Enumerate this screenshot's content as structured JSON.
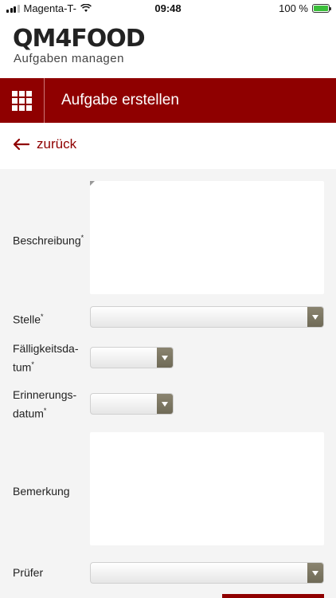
{
  "status_bar": {
    "carrier": "Magenta-T-",
    "time": "09:48",
    "battery": "100 %",
    "signal_icon": "signal-bars-icon",
    "wifi_icon": "wifi-icon",
    "battery_icon": "battery-charging-icon"
  },
  "brand": {
    "logo": "QM4FOOD",
    "tagline": "Aufgaben managen"
  },
  "header": {
    "menu_icon": "grid-menu-icon",
    "title": "Aufgabe erstellen",
    "accent_color": "#8f0000"
  },
  "nav": {
    "back_icon": "arrow-back-icon",
    "back_label": "zurück"
  },
  "form": {
    "beschreibung_label": "Beschreibung",
    "stelle_label": "Stelle",
    "faelligkeit_label_line1": "Fälligkeitsda-",
    "faelligkeit_label_line2": "tum",
    "erinnerung_label_line1": "Erinnerungs-",
    "erinnerung_label_line2": "datum",
    "bemerkung_label": "Bemerkung",
    "pruefer_label": "Prüfer",
    "required_marker": "*"
  }
}
